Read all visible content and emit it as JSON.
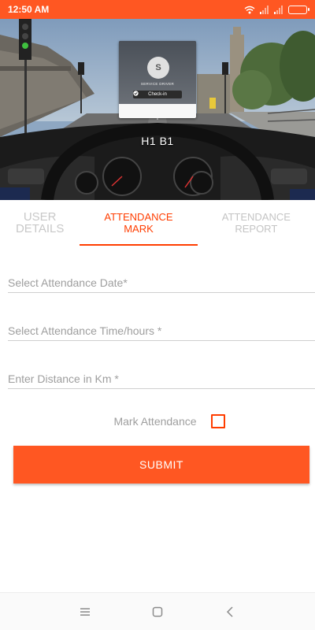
{
  "status_bar": {
    "time": "12:50 AM",
    "icons": [
      "wifi-icon",
      "signal-icon",
      "signal-icon",
      "battery-icon"
    ]
  },
  "header": {
    "caption": "H1 B1",
    "card": {
      "avatar_initial": "S",
      "name": "SERVICE DRIVER",
      "checkin_label": "Check-in"
    }
  },
  "tabs": [
    {
      "label": "USER DETAILS",
      "active": false
    },
    {
      "label": "ATTENDANCE MARK",
      "active": true
    },
    {
      "label": "ATTENDANCE REPORT",
      "active": false
    }
  ],
  "form": {
    "date_placeholder": "Select Attendance Date*",
    "time_placeholder": "Select Attendance Time/hours *",
    "distance_placeholder": "Enter Distance in Km *",
    "mark_label": "Mark Attendance",
    "mark_checked": false,
    "submit_label": "SUBMIT"
  },
  "navigation": {
    "buttons": [
      "menu-icon",
      "home-icon",
      "back-icon"
    ]
  },
  "colors": {
    "accent": "#ff5722",
    "tab_active": "#ff3d00",
    "tab_inactive": "#c4c4c4"
  }
}
